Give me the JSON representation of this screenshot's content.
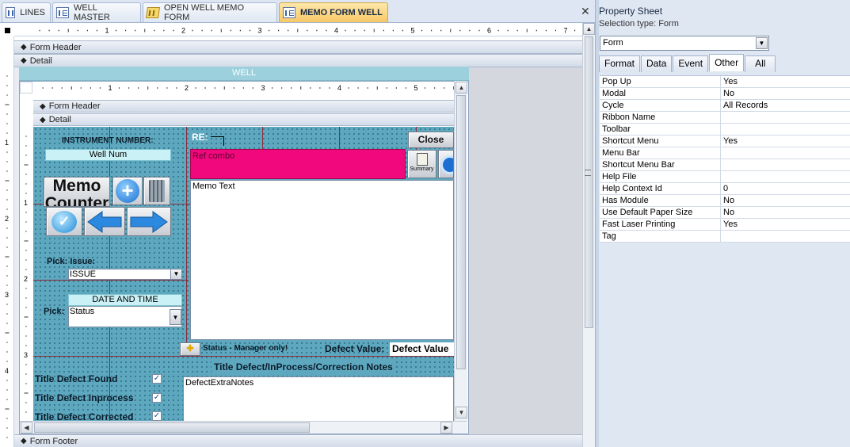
{
  "tabs": [
    {
      "label": "LINES",
      "icon": "table-icon"
    },
    {
      "label": "WELL MASTER",
      "icon": "form-icon"
    },
    {
      "label": "OPEN WELL MEMO FORM",
      "icon": "memo-form-icon"
    },
    {
      "label": "MEMO FORM WELL",
      "icon": "form-icon",
      "active": true
    }
  ],
  "close_glyph": "✕",
  "ruler": {
    "h": [
      "1",
      "2",
      "3",
      "4",
      "5",
      "6",
      "7"
    ],
    "v": [
      "1",
      "2",
      "3",
      "4"
    ],
    "sub_h": [
      "1",
      "2",
      "3",
      "4",
      "5"
    ],
    "sub_v": [
      "1",
      "2",
      "3",
      "4"
    ]
  },
  "sections": {
    "form_header": "Form Header",
    "detail": "Detail",
    "form_footer": "Form Footer"
  },
  "subform": {
    "title": "WELL",
    "form_header": "Form Header",
    "detail": "Detail",
    "instrument_label": "INSTRUMENT NUMBER:",
    "well_num": "Well Num",
    "memo_counter": "Memo Counter",
    "re_label": "RE:",
    "close_label": "Close",
    "ref_combo": "Ref combo",
    "summary_label": "Summary",
    "memo_text": "Memo Text",
    "pick_issue": "Pick: Issue:",
    "issue_value": "ISSUE",
    "date_time": "DATE AND TIME",
    "pick_label": "Pick:",
    "status_value": "Status",
    "status_manager": "Status - Manager only!",
    "defect_value_label": "Defect Value:",
    "defect_value": "Defect Value",
    "notes_header": "Title Defect/InProcess/Correction Notes",
    "defect_notes": "DefectExtraNotes",
    "checks": [
      {
        "label": "Title Defect Found",
        "checked": true
      },
      {
        "label": "Title Defect Inprocess",
        "checked": true
      },
      {
        "label": "Title Defect Corrected",
        "checked": true
      }
    ]
  },
  "property_sheet": {
    "title": "Property Sheet",
    "selection_type": "Selection type:  Form",
    "selected": "Form",
    "tabs": [
      "Format",
      "Data",
      "Event",
      "Other",
      "All"
    ],
    "active_tab": "Other",
    "rows": [
      {
        "name": "Pop Up",
        "value": "Yes"
      },
      {
        "name": "Modal",
        "value": "No"
      },
      {
        "name": "Cycle",
        "value": "All Records"
      },
      {
        "name": "Ribbon Name",
        "value": ""
      },
      {
        "name": "Toolbar",
        "value": ""
      },
      {
        "name": "Shortcut Menu",
        "value": "Yes"
      },
      {
        "name": "Menu Bar",
        "value": ""
      },
      {
        "name": "Shortcut Menu Bar",
        "value": ""
      },
      {
        "name": "Help File",
        "value": ""
      },
      {
        "name": "Help Context Id",
        "value": "0"
      },
      {
        "name": "Has Module",
        "value": "No"
      },
      {
        "name": "Use Default Paper Size",
        "value": "No"
      },
      {
        "name": "Fast Laser Printing",
        "value": "Yes"
      },
      {
        "name": "Tag",
        "value": ""
      }
    ]
  },
  "colors": {
    "active_tab": "#f6c866",
    "detail_bg": "#5ea8bf",
    "ref_combo": "#f0087c",
    "wellbar": "#9cd0dd"
  }
}
